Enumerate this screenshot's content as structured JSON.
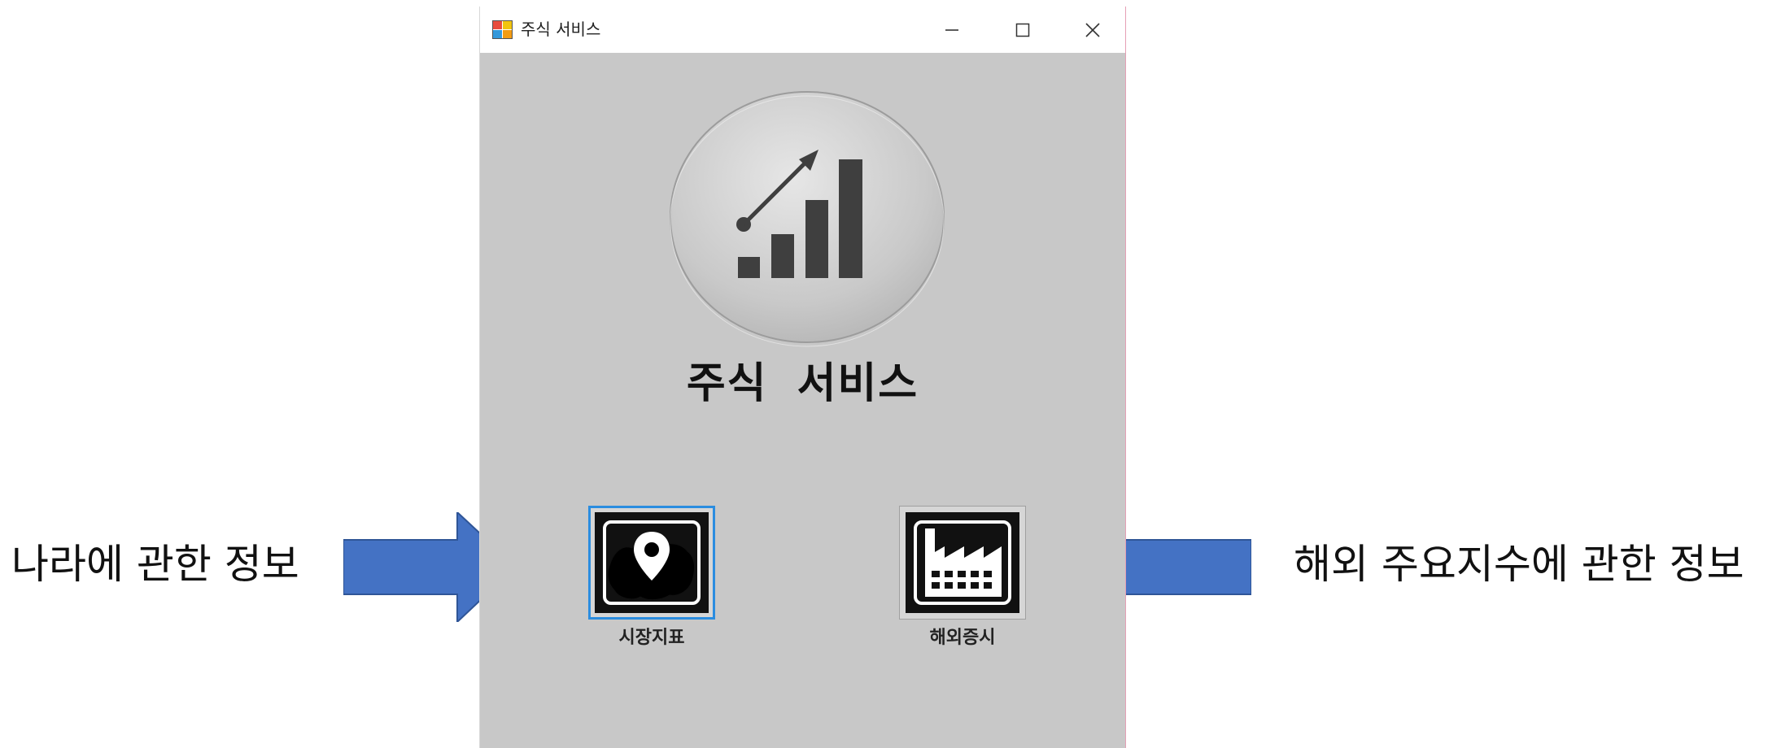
{
  "window": {
    "title": "주식 서비스",
    "controls": {
      "minimize": "–",
      "maximize": "☐",
      "close": "✕"
    }
  },
  "main": {
    "heading": "주식 서비스",
    "logo_icon": "stock-growth-chart-icon",
    "buttons": [
      {
        "label": "시장지표",
        "icon": "map-location-pin-icon"
      },
      {
        "label": "해외증시",
        "icon": "factory-icon"
      }
    ]
  },
  "annotations": {
    "left_note": "나라에 관한 정보",
    "right_note": "해외 주요지수에 관한 정보",
    "arrow_color": "#4472c4"
  },
  "colors": {
    "window_bg": "#c8c8c8",
    "selected_border": "#2b8de0"
  }
}
